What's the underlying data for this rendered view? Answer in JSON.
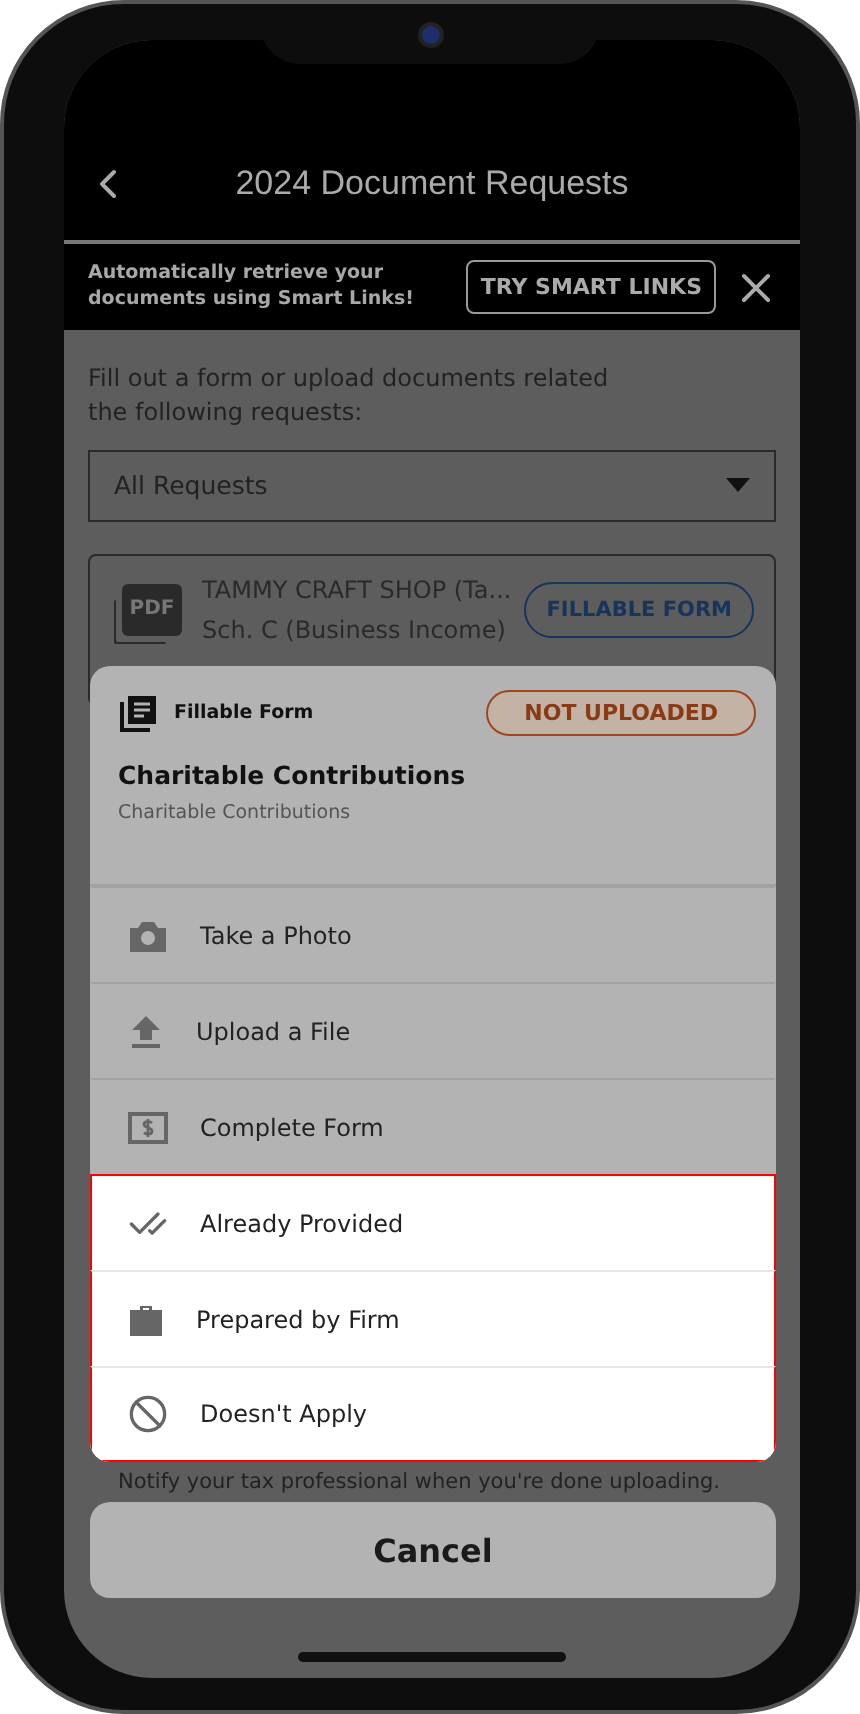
{
  "header": {
    "title": "2024 Document Requests"
  },
  "banner": {
    "text": "Automatically retrieve your documents using Smart Links!",
    "button": "TRY SMART LINKS"
  },
  "intro": "Fill out a form or upload documents related the following requests:",
  "filter": {
    "value": "All Requests"
  },
  "requests": [
    {
      "icon_text": "PDF",
      "title": "TAMMY CRAFT SHOP (Ta...",
      "subtitle": "Sch. C (Business Income)",
      "action": "FILLABLE FORM"
    }
  ],
  "sheet": {
    "type_label": "Fillable Form",
    "status": "NOT UPLOADED",
    "title": "Charitable Contributions",
    "description": "Charitable Contributions",
    "options": [
      {
        "kind": "camera",
        "label": "Take a Photo",
        "highlighted": false
      },
      {
        "kind": "upload",
        "label": "Upload a File",
        "highlighted": false
      },
      {
        "kind": "form",
        "label": "Complete Form",
        "highlighted": false
      },
      {
        "kind": "provided",
        "label": "Already Provided",
        "highlighted": true
      },
      {
        "kind": "firm",
        "label": "Prepared by Firm",
        "highlighted": true
      },
      {
        "kind": "na",
        "label": "Doesn't Apply",
        "highlighted": true
      }
    ]
  },
  "notice": "Notify your tax professional when you're done uploading.",
  "cancel": "Cancel"
}
